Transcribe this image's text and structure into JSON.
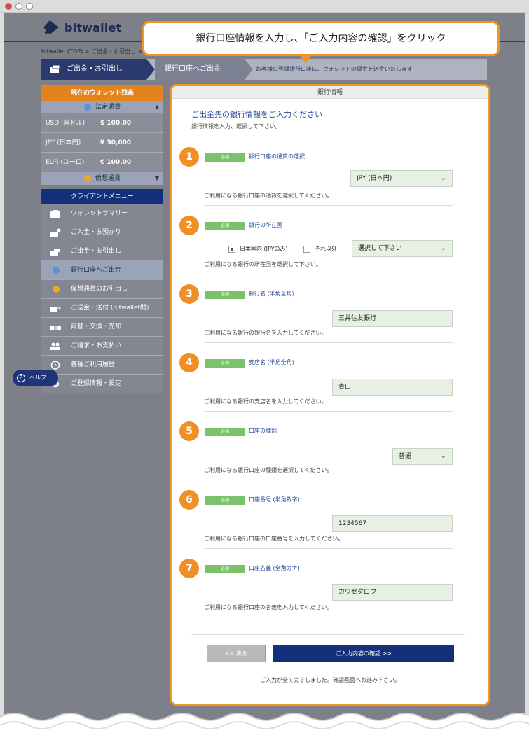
{
  "header": {
    "logo_text": "bitwallet"
  },
  "breadcrumb": "bitwallet (TOP)  >  ご出金・お引出し  >",
  "steps": {
    "step1": "ご出金・お引出し",
    "step2": "銀行口座へご出金",
    "step3": "お客様の登録銀行口座に、ウォレットの資金を送金いたします"
  },
  "callout": "銀行口座情報を入力し、「ご入力内容の確認」をクリック",
  "sidebar": {
    "wallet_head": "現在のウォレット残高",
    "fiat_head": "法定通貨",
    "balances": [
      {
        "cur": "USD (米ドル)",
        "amt": "$ 100.00"
      },
      {
        "cur": "JPY (日本円)",
        "amt": "¥ 30,000"
      },
      {
        "cur": "EUR (ユーロ)",
        "amt": "€ 100.00"
      }
    ],
    "crypto_head": "仮想通貨",
    "menu_head": "クライアントメニュー",
    "menu": [
      "ウォレットサマリー",
      "ご入金・お預かり",
      "ご出金・お引出し",
      "銀行口座へご出金",
      "仮想通貨のお引出し",
      "ご送金・送付 (bitwallet間)",
      "両替・交換・売却",
      "ご請求・お支払い",
      "各種ご利用履歴",
      "ご登録情報・設定"
    ]
  },
  "help_label": "ヘルプ",
  "panel": {
    "title": "銀行情報",
    "heading": "ご出金先の銀行情報をご入力ください",
    "sub": "銀行情報を入力、選択して下さい。",
    "required": "必須",
    "sections": [
      {
        "num": "1",
        "label": "銀行口座の通貨の選択",
        "value": "JPY (日本円)",
        "hint": "ご利用になる銀行口座の通貨を選択してください。"
      },
      {
        "num": "2",
        "label": "銀行の所在国",
        "radio1": "日本国内 (JPYのみ)",
        "radio2": "それ以外",
        "value": "選択して下さい",
        "hint": "ご利用になる銀行の所在国を選択して下さい。"
      },
      {
        "num": "3",
        "label": "銀行名 (半角全角)",
        "value": "三井住友銀行",
        "hint": "ご利用になる銀行の銀行名を入力してください。"
      },
      {
        "num": "4",
        "label": "支店名 (半角全角)",
        "value": "青山",
        "hint": "ご利用になる銀行の支店名を入力してください。"
      },
      {
        "num": "5",
        "label": "口座の種別",
        "value": "普通",
        "hint": "ご利用になる銀行口座の種類を選択してください。"
      },
      {
        "num": "6",
        "label": "口座番号 (半角数字)",
        "value": "1234567",
        "hint": "ご利用になる銀行口座の口座番号を入力してください。"
      },
      {
        "num": "7",
        "label": "口座名義 (全角カナ)",
        "value": "カワセタロウ",
        "hint": "ご利用になる銀行口座の名義を入力してください。"
      }
    ],
    "back_label": "<< 戻る",
    "confirm_label": "ご入力内容の確認 >>",
    "done_note": "ご入力が全て完了しました。確認画面へお進み下さい。"
  },
  "colors": {
    "accent_orange": "#f19528",
    "navy": "#14307a",
    "required_green": "#7bc36b",
    "field_bg": "#e6f0e3"
  }
}
